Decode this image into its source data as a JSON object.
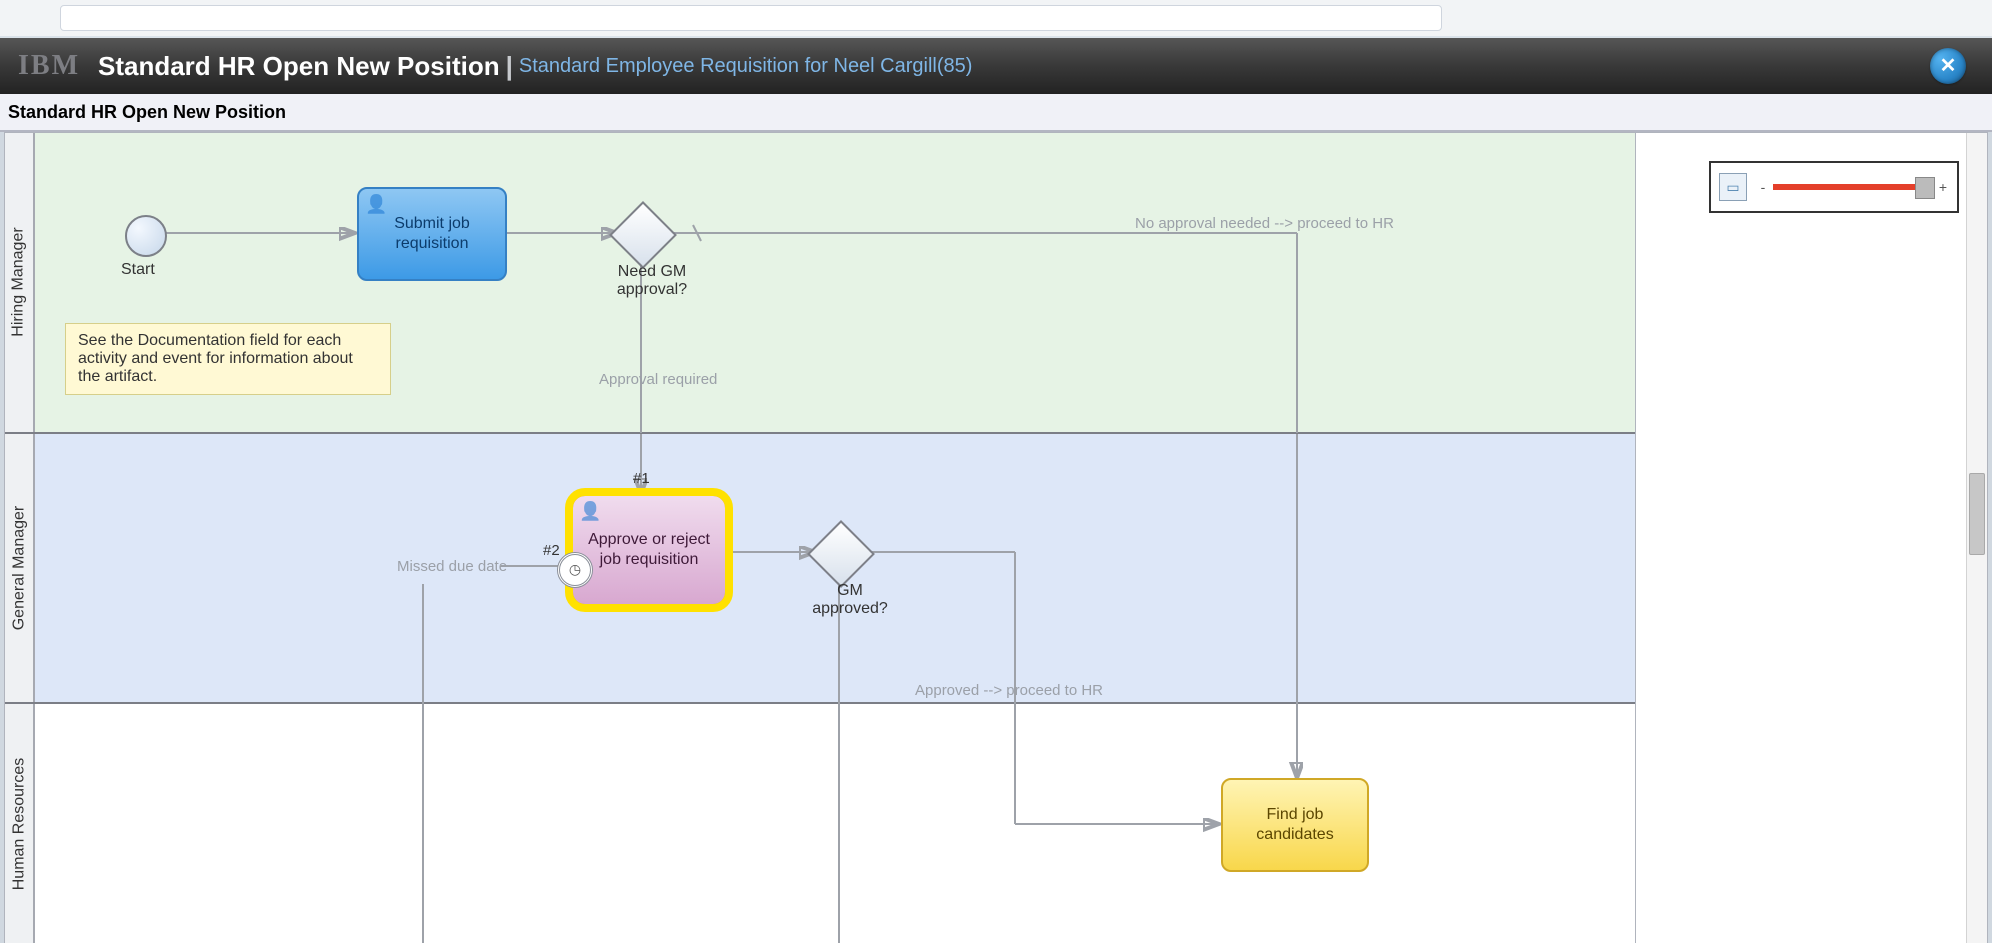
{
  "logo_text": "IBM",
  "header": {
    "title": "Standard HR Open New Position",
    "separator": "|",
    "subtitle": "Standard Employee Requisition for Neel Cargill(85)"
  },
  "subheader": "Standard HR Open New Position",
  "lanes": {
    "hiring_manager": "Hiring Manager",
    "general_manager": "General Manager",
    "human_resources": "Human Resources"
  },
  "hm": {
    "start_label": "Start",
    "task_submit": "Submit job requisition",
    "gw_need_gm": "Need GM approval?",
    "edge_no_approval": "No approval needed --> proceed to HR",
    "edge_approval_required": "Approval required",
    "note": "See the Documentation field for each activity and event for information about the artifact."
  },
  "gm": {
    "task_approve": "Approve or reject job requisition",
    "token1": "#1",
    "token2": "#2",
    "edge_missed": "Missed due date",
    "gw_gm_approved": "GM approved?",
    "edge_approved": "Approved --> proceed to HR"
  },
  "hr": {
    "task_find": "Find job candidates"
  },
  "zoom": {
    "minus": "-",
    "plus": "+"
  }
}
